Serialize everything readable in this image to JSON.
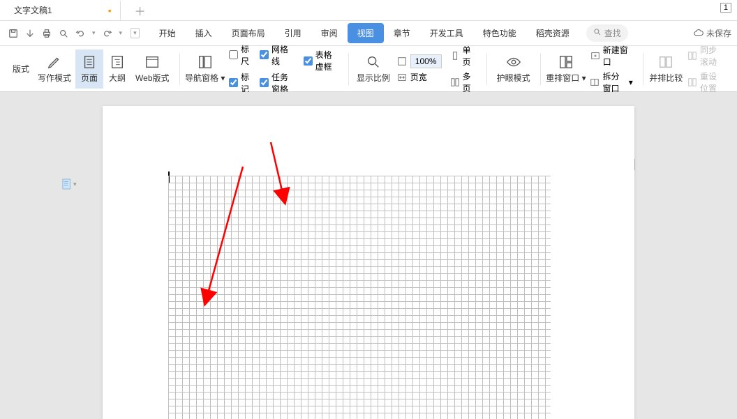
{
  "tabBar": {
    "documentName": "文字文稿1",
    "windowNumber": "1"
  },
  "menu": {
    "tabs": [
      "开始",
      "插入",
      "页面布局",
      "引用",
      "审阅",
      "视图",
      "章节",
      "开发工具",
      "特色功能",
      "稻壳资源"
    ],
    "activeTab": "视图",
    "searchPlaceholder": "查找",
    "saveStatus": "未保存"
  },
  "ribbon": {
    "viewMode": {
      "stub": "版式",
      "writing": "写作模式",
      "page": "页面",
      "outline": "大纲",
      "web": "Web版式"
    },
    "navPane": "导航窗格",
    "checks": {
      "ruler": "标尺",
      "gridlines": "网格线",
      "markup": "标记",
      "taskPane": "任务窗格",
      "tableFrame": "表格虚框"
    },
    "zoom": {
      "showScale": "显示比例",
      "percent": "100%",
      "singlePage": "单页",
      "pageWidth": "页宽",
      "multiPage": "多页"
    },
    "eyeMode": "护眼模式",
    "windows": {
      "arrange": "重排窗口",
      "newWindow": "新建窗口",
      "splitWindow": "拆分窗口",
      "sideBySide": "并排比较",
      "syncScroll": "同步滚动",
      "resetPos": "重设位置"
    }
  }
}
